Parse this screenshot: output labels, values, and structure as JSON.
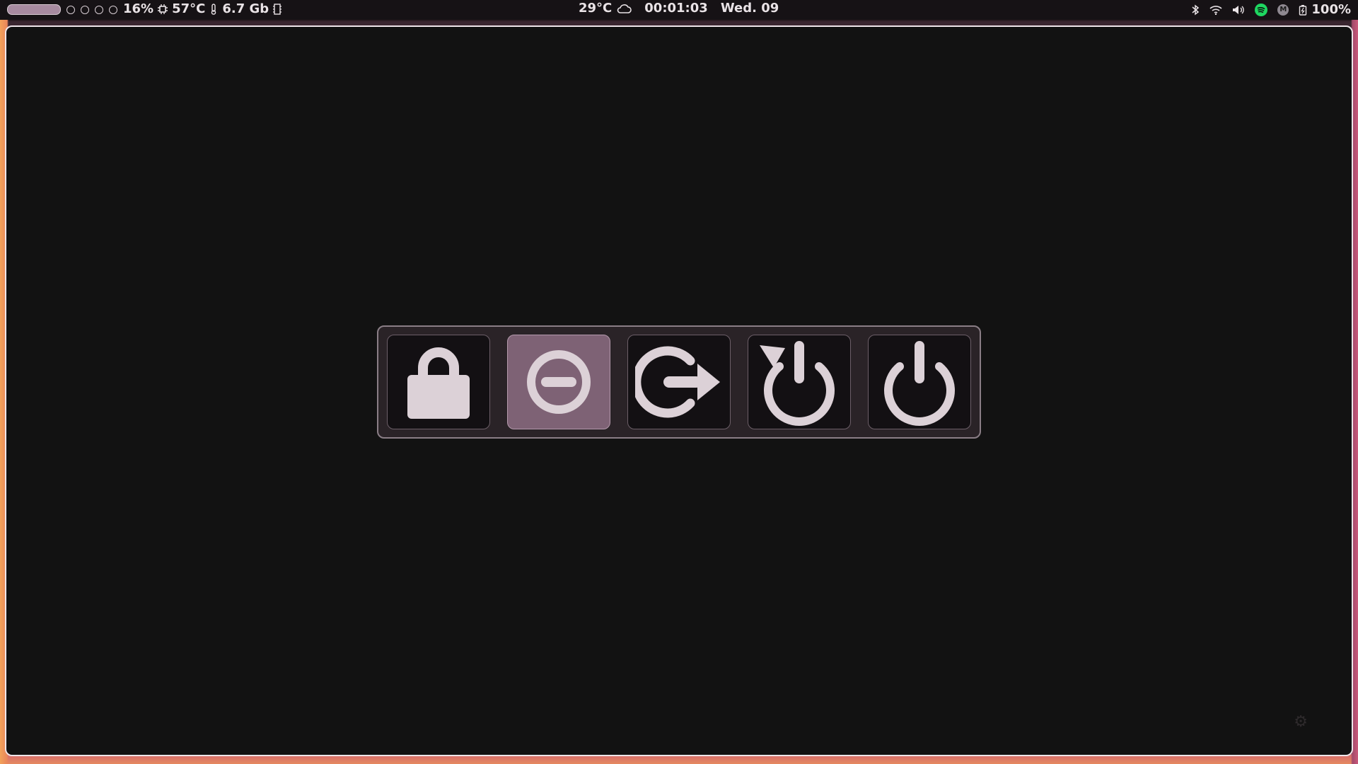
{
  "topbar": {
    "cpu": "16%",
    "cpu_temp": "57°C",
    "ram": "6.7 Gb",
    "weather_temp": "29°C",
    "time": "00:01:03",
    "date": "Wed. 09",
    "battery": "100%",
    "mail_badge": "M"
  },
  "power_menu": {
    "selected_index": 1,
    "buttons": [
      {
        "icon": "lock-icon"
      },
      {
        "icon": "suspend-icon"
      },
      {
        "icon": "logout-icon"
      },
      {
        "icon": "reboot-icon"
      },
      {
        "icon": "shutdown-icon"
      }
    ]
  },
  "colors": {
    "icon": "#dcd1d7",
    "selected_bg": "#7e6275",
    "panel_bg": "#2a2327",
    "window_bg": "#121212",
    "spotify": "#1ed760"
  }
}
